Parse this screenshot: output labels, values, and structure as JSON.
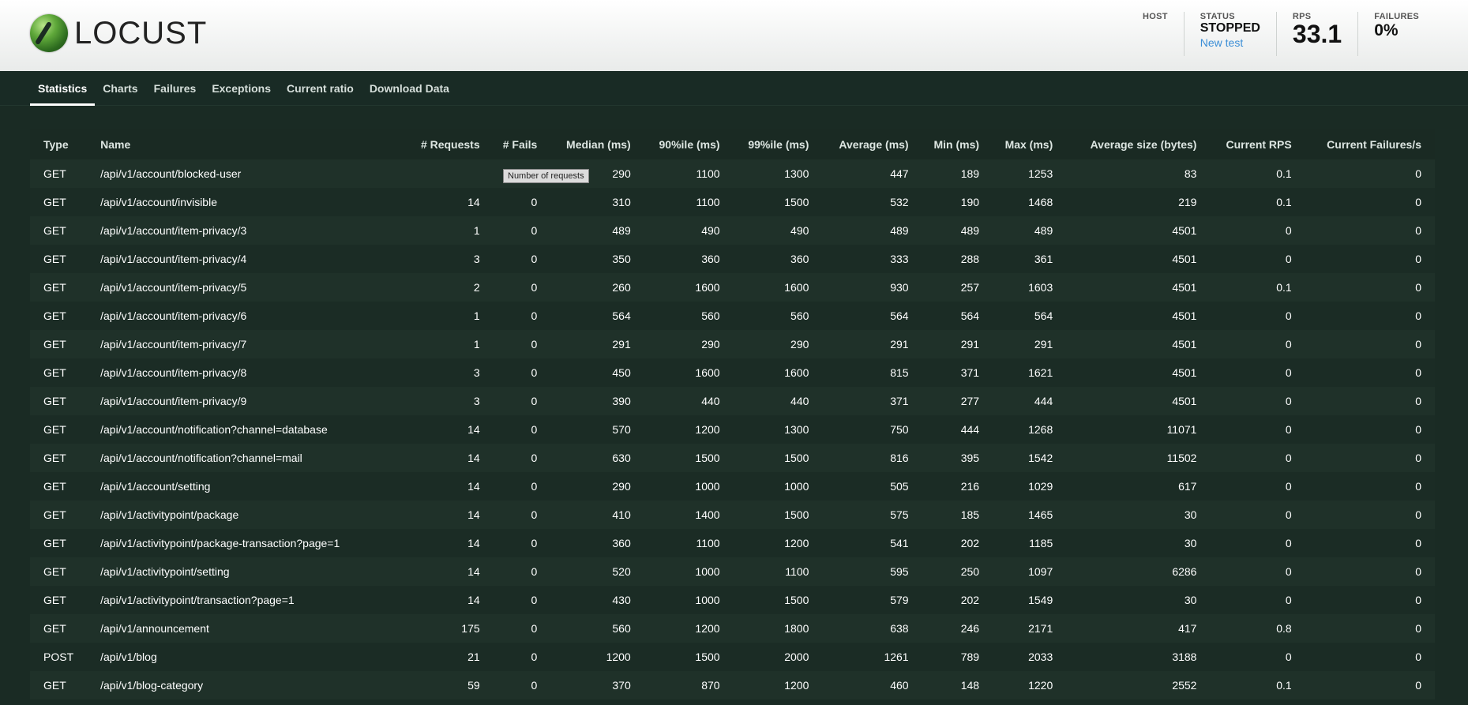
{
  "header": {
    "logo_text": "LOCUST",
    "host_label": "HOST",
    "status_label": "STATUS",
    "status_value": "STOPPED",
    "new_test_link": "New test",
    "rps_label": "RPS",
    "rps_value": "33.1",
    "failures_label": "FAILURES",
    "failures_value": "0%"
  },
  "nav": {
    "tabs": [
      "Statistics",
      "Charts",
      "Failures",
      "Exceptions",
      "Current ratio",
      "Download Data"
    ]
  },
  "tooltip": "Number of requests",
  "table": {
    "columns": [
      "Type",
      "Name",
      "# Requests",
      "# Fails",
      "Median (ms)",
      "90%ile (ms)",
      "99%ile (ms)",
      "Average (ms)",
      "Min (ms)",
      "Max (ms)",
      "Average size (bytes)",
      "Current RPS",
      "Current Failures/s"
    ],
    "rows": [
      [
        "GET",
        "/api/v1/account/blocked-user",
        "",
        "0",
        "290",
        "1100",
        "1300",
        "447",
        "189",
        "1253",
        "83",
        "0.1",
        "0"
      ],
      [
        "GET",
        "/api/v1/account/invisible",
        "14",
        "0",
        "310",
        "1100",
        "1500",
        "532",
        "190",
        "1468",
        "219",
        "0.1",
        "0"
      ],
      [
        "GET",
        "/api/v1/account/item-privacy/3",
        "1",
        "0",
        "489",
        "490",
        "490",
        "489",
        "489",
        "489",
        "4501",
        "0",
        "0"
      ],
      [
        "GET",
        "/api/v1/account/item-privacy/4",
        "3",
        "0",
        "350",
        "360",
        "360",
        "333",
        "288",
        "361",
        "4501",
        "0",
        "0"
      ],
      [
        "GET",
        "/api/v1/account/item-privacy/5",
        "2",
        "0",
        "260",
        "1600",
        "1600",
        "930",
        "257",
        "1603",
        "4501",
        "0.1",
        "0"
      ],
      [
        "GET",
        "/api/v1/account/item-privacy/6",
        "1",
        "0",
        "564",
        "560",
        "560",
        "564",
        "564",
        "564",
        "4501",
        "0",
        "0"
      ],
      [
        "GET",
        "/api/v1/account/item-privacy/7",
        "1",
        "0",
        "291",
        "290",
        "290",
        "291",
        "291",
        "291",
        "4501",
        "0",
        "0"
      ],
      [
        "GET",
        "/api/v1/account/item-privacy/8",
        "3",
        "0",
        "450",
        "1600",
        "1600",
        "815",
        "371",
        "1621",
        "4501",
        "0",
        "0"
      ],
      [
        "GET",
        "/api/v1/account/item-privacy/9",
        "3",
        "0",
        "390",
        "440",
        "440",
        "371",
        "277",
        "444",
        "4501",
        "0",
        "0"
      ],
      [
        "GET",
        "/api/v1/account/notification?channel=database",
        "14",
        "0",
        "570",
        "1200",
        "1300",
        "750",
        "444",
        "1268",
        "11071",
        "0",
        "0"
      ],
      [
        "GET",
        "/api/v1/account/notification?channel=mail",
        "14",
        "0",
        "630",
        "1500",
        "1500",
        "816",
        "395",
        "1542",
        "11502",
        "0",
        "0"
      ],
      [
        "GET",
        "/api/v1/account/setting",
        "14",
        "0",
        "290",
        "1000",
        "1000",
        "505",
        "216",
        "1029",
        "617",
        "0",
        "0"
      ],
      [
        "GET",
        "/api/v1/activitypoint/package",
        "14",
        "0",
        "410",
        "1400",
        "1500",
        "575",
        "185",
        "1465",
        "30",
        "0",
        "0"
      ],
      [
        "GET",
        "/api/v1/activitypoint/package-transaction?page=1",
        "14",
        "0",
        "360",
        "1100",
        "1200",
        "541",
        "202",
        "1185",
        "30",
        "0",
        "0"
      ],
      [
        "GET",
        "/api/v1/activitypoint/setting",
        "14",
        "0",
        "520",
        "1000",
        "1100",
        "595",
        "250",
        "1097",
        "6286",
        "0",
        "0"
      ],
      [
        "GET",
        "/api/v1/activitypoint/transaction?page=1",
        "14",
        "0",
        "430",
        "1000",
        "1500",
        "579",
        "202",
        "1549",
        "30",
        "0",
        "0"
      ],
      [
        "GET",
        "/api/v1/announcement",
        "175",
        "0",
        "560",
        "1200",
        "1800",
        "638",
        "246",
        "2171",
        "417",
        "0.8",
        "0"
      ],
      [
        "POST",
        "/api/v1/blog",
        "21",
        "0",
        "1200",
        "1500",
        "2000",
        "1261",
        "789",
        "2033",
        "3188",
        "0",
        "0"
      ],
      [
        "GET",
        "/api/v1/blog-category",
        "59",
        "0",
        "370",
        "870",
        "1200",
        "460",
        "148",
        "1220",
        "2552",
        "0.1",
        "0"
      ]
    ]
  }
}
